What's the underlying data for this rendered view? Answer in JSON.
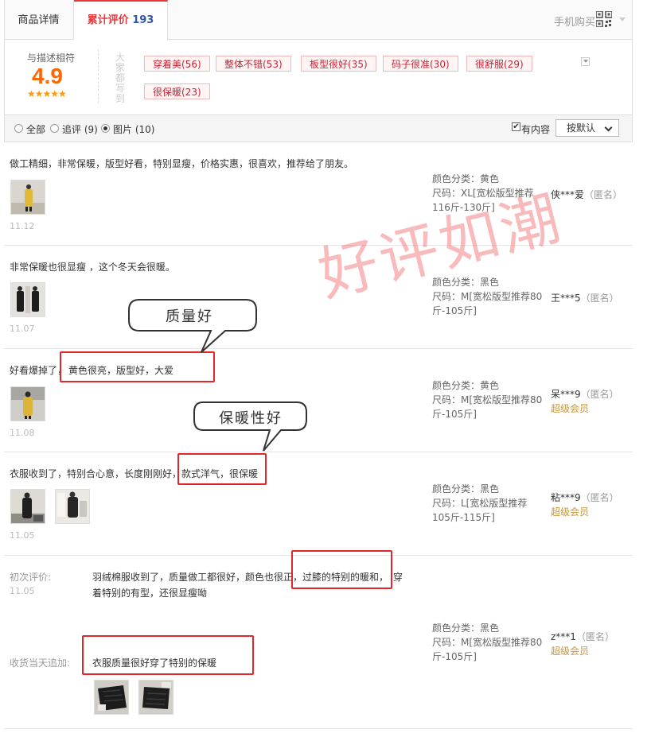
{
  "tabs": {
    "details": "商品详情",
    "reviews": "累计评价",
    "review_count": "193"
  },
  "mobile_buy": "手机购买",
  "rating": {
    "label": "与描述相符",
    "score": "4.9",
    "stars": "★★★★★"
  },
  "everyone_says": "大家都写到",
  "tags": [
    "穿着美(56)",
    "整体不错(53)",
    "板型很好(35)",
    "码子很准(30)",
    "很舒服(29)",
    "很保暖(23)"
  ],
  "filter": {
    "all": "全部",
    "append": "追评 (9)",
    "pictures": "图片 (10)",
    "has_content": "有内容",
    "sort": "按默认"
  },
  "reviews": [
    {
      "text": "做工精细，非常保暖，版型好看，特别显瘦，价格实惠，很喜欢，推荐给了朋友。",
      "date": "11.12",
      "color": "颜色分类：黄色",
      "size1": "尺码：XL[宽松版型推荐",
      "size2": "116斤-130斤]",
      "user": "侠***爱",
      "anon": "（匿名）",
      "vip": ""
    },
    {
      "text": "非常保暖也很显瘦 ，这个冬天会很暖。",
      "date": "11.07",
      "color": "颜色分类：黑色",
      "size1": "尺码：M[宽松版型推荐80",
      "size2": "斤-105斤]",
      "user": "王***5",
      "anon": "（匿名）",
      "vip": ""
    },
    {
      "text_a": "好看爆掉了，",
      "text_b": "黄色很亮，版型好，大爱",
      "date": "11.08",
      "color": "颜色分类：黄色",
      "size1": "尺码：M[宽松版型推荐80",
      "size2": "斤-105斤]",
      "user": "呆***9",
      "anon": "（匿名）",
      "vip": "超级会员"
    },
    {
      "text_a": "衣服收到了，特别合心意，长度刚刚好，",
      "text_b": "款式洋气，很保暖",
      "date": "11.05",
      "color": "颜色分类：黑色",
      "size1": "尺码：L[宽松版型推荐",
      "size2": "105斤-115斤]",
      "user": "粘***9",
      "anon": "（匿名）",
      "vip": "超级会员"
    },
    {
      "first_label": "初次评价:",
      "date": "11.05",
      "text_a": "羽绒棉服收到了，质量做工都很好，颜色也很正，",
      "text_b": "过膝的特别的暖和，",
      "text_c": "穿",
      "text_d": "着特别的有型，还很显瘦呦",
      "append_label": "收货当天追加:",
      "append_text": "衣服质量很好穿了特别的保暖",
      "color": "颜色分类：黑色",
      "size1": "尺码：M[宽松版型推荐80",
      "size2": "斤-105斤]",
      "user": "z***1",
      "anon": "（匿名）",
      "vip": "超级会员"
    }
  ],
  "callouts": {
    "quality": "质量好",
    "warmth": "保暖性好"
  },
  "watermark": "好评如潮",
  "colors": {
    "accent": "#e4393c",
    "score": "#ff6600",
    "vip": "#c8963e",
    "box": "#e3262b"
  }
}
